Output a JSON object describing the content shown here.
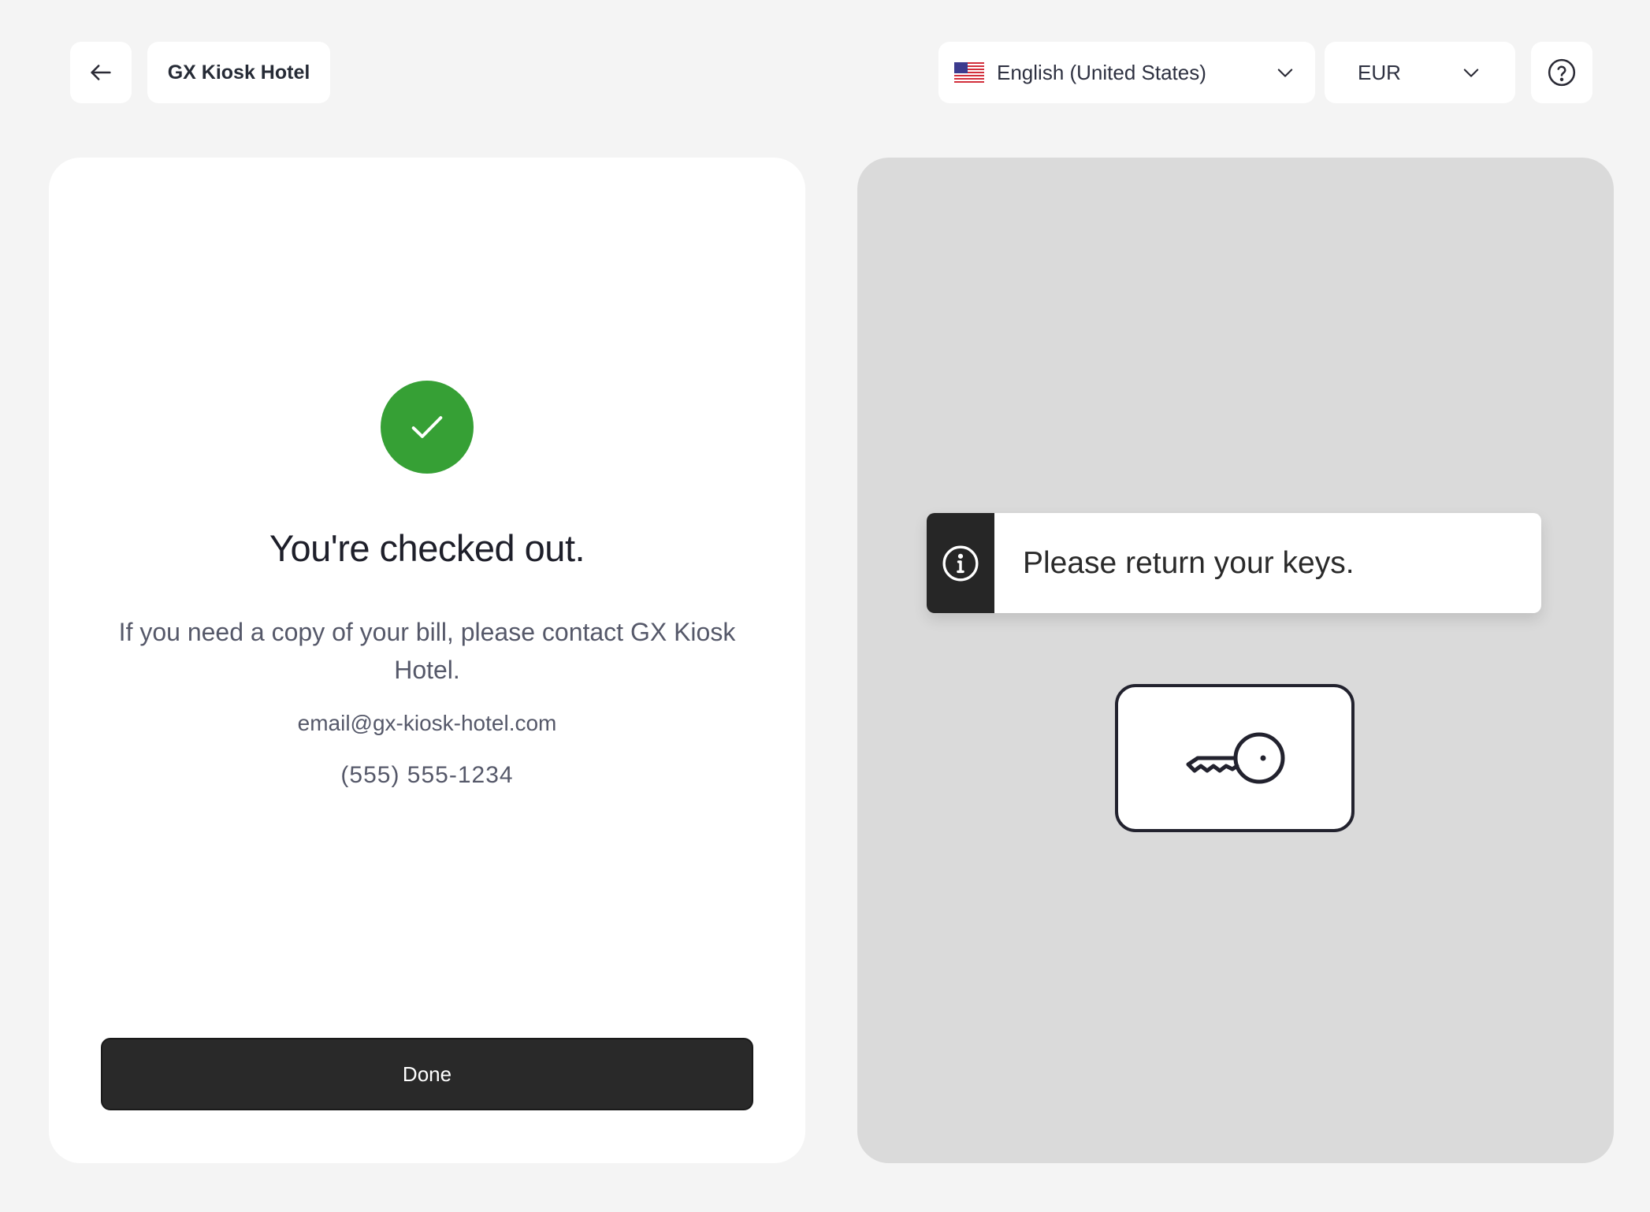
{
  "header": {
    "hotel_name": "GX Kiosk Hotel",
    "language": "English (United States)",
    "currency": "EUR"
  },
  "icons": {
    "back": "arrow-left-icon",
    "flag": "us-flag-icon",
    "chevron": "chevron-down-icon",
    "help": "question-circle-icon",
    "success": "check-icon",
    "info": "info-circle-icon",
    "key": "key-icon"
  },
  "checkout": {
    "title": "You're checked out.",
    "description": "If you need a copy of your bill, please contact GX Kiosk Hotel.",
    "email": "email@gx-kiosk-hotel.com",
    "phone": "(555) 555-1234",
    "done_label": "Done"
  },
  "keys_panel": {
    "notice": "Please return your keys."
  },
  "colors": {
    "success": "#36a035",
    "primary_button": "#292929",
    "panel_bg": "#dadada",
    "page_bg": "#f4f4f4"
  }
}
